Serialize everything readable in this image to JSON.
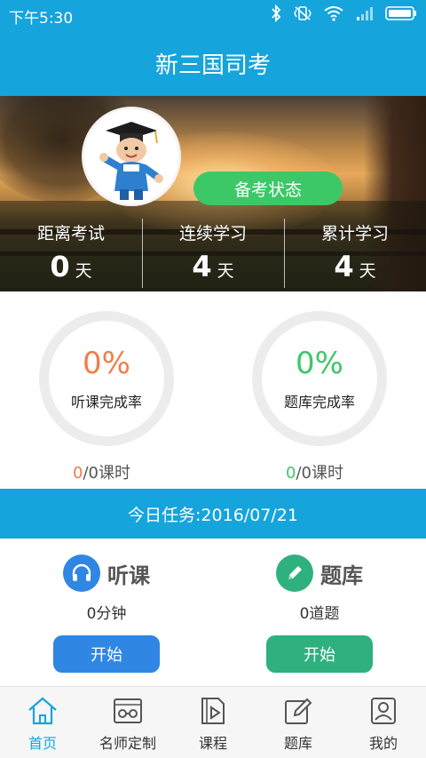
{
  "status_bar": {
    "time": "下午5:30"
  },
  "header": {
    "title": "新三国司考"
  },
  "banner": {
    "status_button": "备考状态",
    "stats": [
      {
        "label": "距离考试",
        "value": "0",
        "unit": "天"
      },
      {
        "label": "连续学习",
        "value": "4",
        "unit": "天"
      },
      {
        "label": "累计学习",
        "value": "4",
        "unit": "天"
      }
    ]
  },
  "progress": [
    {
      "percent": "0%",
      "label": "听课完成率",
      "done": "0",
      "total": "/0课时",
      "color": "#ef7e4c"
    },
    {
      "percent": "0%",
      "label": "题库完成率",
      "done": "0",
      "total": "/0课时",
      "color": "#3cc867"
    }
  ],
  "today": {
    "title": "今日任务:2016/07/21"
  },
  "tasks": [
    {
      "title": "听课",
      "sub": "0分钟",
      "button": "开始",
      "color": "#2f86e3",
      "icon": "headphones-icon"
    },
    {
      "title": "题库",
      "sub": "0道题",
      "button": "开始",
      "color": "#2fb07f",
      "icon": "pencil-icon"
    }
  ],
  "nav": [
    {
      "label": "首页",
      "icon": "home-icon",
      "active": true
    },
    {
      "label": "名师定制",
      "icon": "glasses-icon"
    },
    {
      "label": "课程",
      "icon": "video-icon"
    },
    {
      "label": "题库",
      "icon": "edit-icon"
    },
    {
      "label": "我的",
      "icon": "profile-icon"
    }
  ],
  "colors": {
    "accent": "#16a4dc",
    "green": "#3cc867",
    "orange": "#ef7e4c"
  }
}
